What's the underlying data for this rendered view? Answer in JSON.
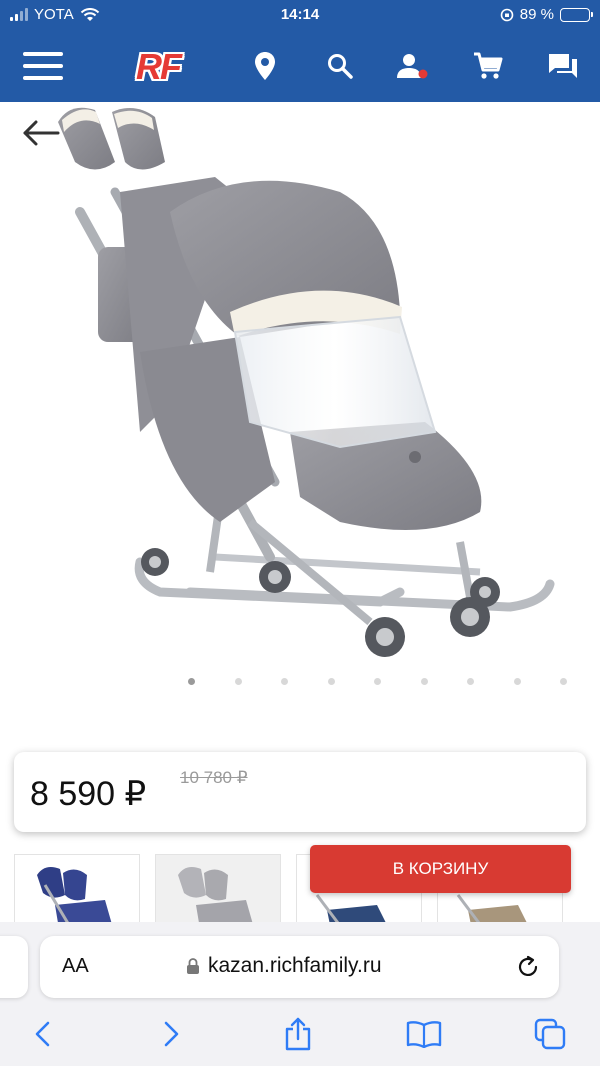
{
  "status_bar": {
    "carrier": "YOTA",
    "time": "14:14",
    "battery_percent": "89 %",
    "battery_level": 0.89
  },
  "app_bar": {
    "logo_text": "RF",
    "icons": [
      "menu-icon",
      "location-pin-icon",
      "search-icon",
      "account-icon",
      "cart-icon",
      "chat-icon"
    ]
  },
  "gallery": {
    "slide_count": 9,
    "active_slide": 1
  },
  "product": {
    "price": "8 590 ₽",
    "old_price": "10 780 ₽"
  },
  "actions": {
    "add_to_cart_label": "В КОРЗИНУ"
  },
  "browser": {
    "text_size_label": "AA",
    "url": "kazan.richfamily.ru"
  },
  "colors": {
    "header_blue": "#235aa6",
    "cart_red": "#d83a32",
    "logo_red": "#e53a35",
    "safari_blue": "#2f7cf6"
  }
}
